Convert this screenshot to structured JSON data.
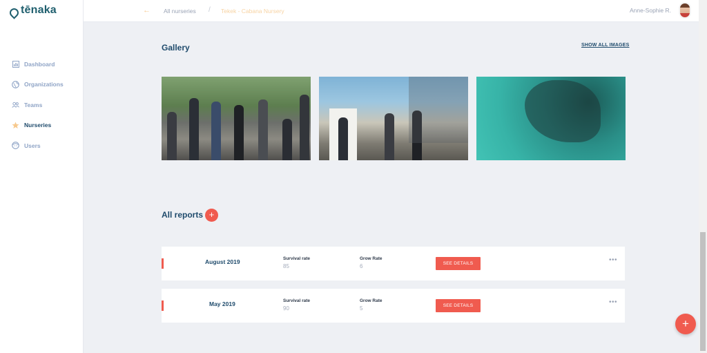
{
  "app": {
    "brand": "tēnaka"
  },
  "sidebar": {
    "items": [
      {
        "label": "Dashboard",
        "icon": "chart-icon"
      },
      {
        "label": "Organizations",
        "icon": "globe-icon"
      },
      {
        "label": "Teams",
        "icon": "people-icon"
      },
      {
        "label": "Nurseries",
        "icon": "star-icon",
        "active": true
      },
      {
        "label": "Users",
        "icon": "user-face-icon"
      }
    ]
  },
  "topbar": {
    "back_icon": "arrow-left-icon",
    "breadcrumb_root": "All nurseries",
    "breadcrumb_sep": "/",
    "breadcrumb_current": "Tekek - Cabana Nursery",
    "user_name": "Anne-Sophie R."
  },
  "gallery": {
    "title": "Gallery",
    "show_all": "SHOW ALL IMAGES"
  },
  "reports": {
    "title": "All reports",
    "add_symbol": "+",
    "items": [
      {
        "month": "August 2019",
        "survival_label": "Survival rate",
        "survival_value": "85",
        "grow_label": "Grow Rate",
        "grow_value": "6",
        "details_label": "SEE DETAILS",
        "more": "•••"
      },
      {
        "month": "May 2019",
        "survival_label": "Survival rate",
        "survival_value": "90",
        "grow_label": "Grow Rate",
        "grow_value": "5",
        "details_label": "SEE DETAILS",
        "more": "•••"
      }
    ]
  },
  "fab": {
    "symbol": "+"
  },
  "colors": {
    "accent": "#f05b4f",
    "brand": "#1f5f6e",
    "nav_text": "#8fa4c6",
    "heading": "#1f4b6c",
    "background": "#eef0f4"
  }
}
